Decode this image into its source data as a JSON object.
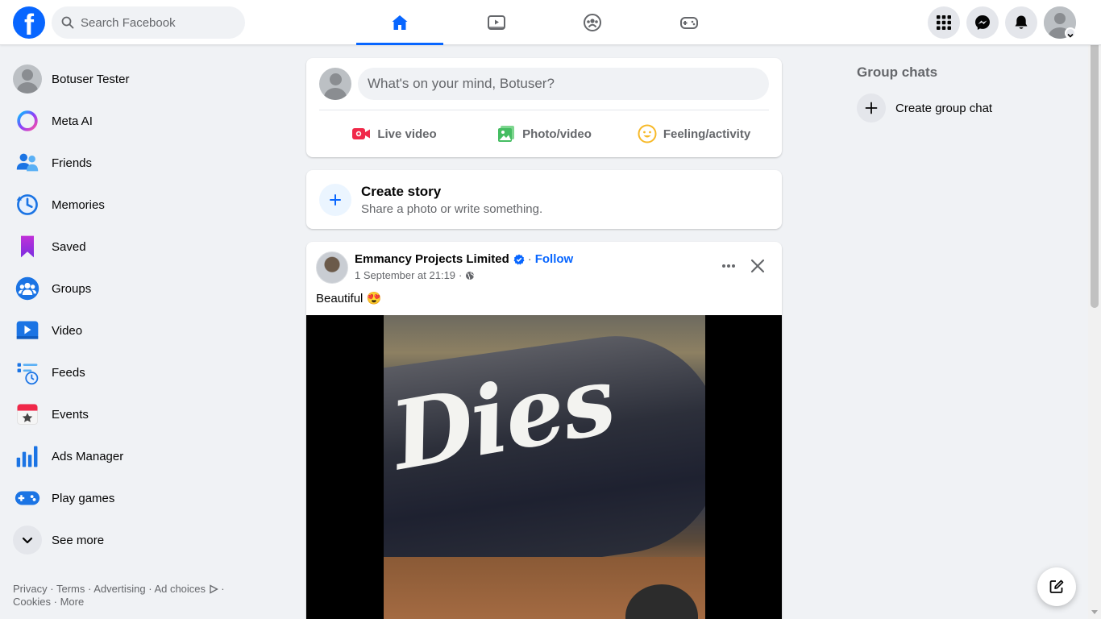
{
  "header": {
    "logo": "f",
    "search_placeholder": "Search Facebook",
    "tabs": [
      {
        "name": "home",
        "icon": "home-icon",
        "active": true
      },
      {
        "name": "video",
        "icon": "video-icon",
        "active": false
      },
      {
        "name": "groups",
        "icon": "groups-icon",
        "active": false
      },
      {
        "name": "gaming",
        "icon": "gaming-icon",
        "active": false
      }
    ],
    "right_buttons": [
      "menu-grid-icon",
      "messenger-icon",
      "notifications-icon",
      "account-icon"
    ]
  },
  "sidebar": {
    "items": [
      {
        "label": "Botuser Tester",
        "icon": "profile-avatar"
      },
      {
        "label": "Meta AI",
        "icon": "meta-ai-icon"
      },
      {
        "label": "Friends",
        "icon": "friends-icon"
      },
      {
        "label": "Memories",
        "icon": "memories-icon"
      },
      {
        "label": "Saved",
        "icon": "saved-icon"
      },
      {
        "label": "Groups",
        "icon": "groups-icon"
      },
      {
        "label": "Video",
        "icon": "video-icon"
      },
      {
        "label": "Feeds",
        "icon": "feeds-icon"
      },
      {
        "label": "Events",
        "icon": "events-icon"
      },
      {
        "label": "Ads Manager",
        "icon": "ads-manager-icon"
      },
      {
        "label": "Play games",
        "icon": "play-games-icon"
      },
      {
        "label": "See more",
        "icon": "chevron-down-icon"
      }
    ],
    "footer": {
      "privacy": "Privacy",
      "terms": "Terms",
      "advertising": "Advertising",
      "ad_choices": "Ad choices",
      "cookies": "Cookies",
      "more": "More",
      "sep": "·"
    }
  },
  "composer": {
    "placeholder": "What's on your mind, Botuser?",
    "actions": [
      {
        "label": "Live video",
        "color": "#f02849"
      },
      {
        "label": "Photo/video",
        "color": "#45bd62"
      },
      {
        "label": "Feeling/activity",
        "color": "#f7b928"
      }
    ]
  },
  "story": {
    "title": "Create story",
    "subtitle": "Share a photo or write something."
  },
  "post": {
    "author": "Emmancy Projects Limited",
    "follow": "Follow",
    "timestamp": "1 September at 21:19",
    "text": "Beautiful 😍",
    "media_text": "Dies"
  },
  "right_column": {
    "title": "Group chats",
    "create_label": "Create group chat"
  },
  "colors": {
    "accent": "#0866ff",
    "background": "#f0f2f5",
    "secondary_text": "#65676b"
  }
}
